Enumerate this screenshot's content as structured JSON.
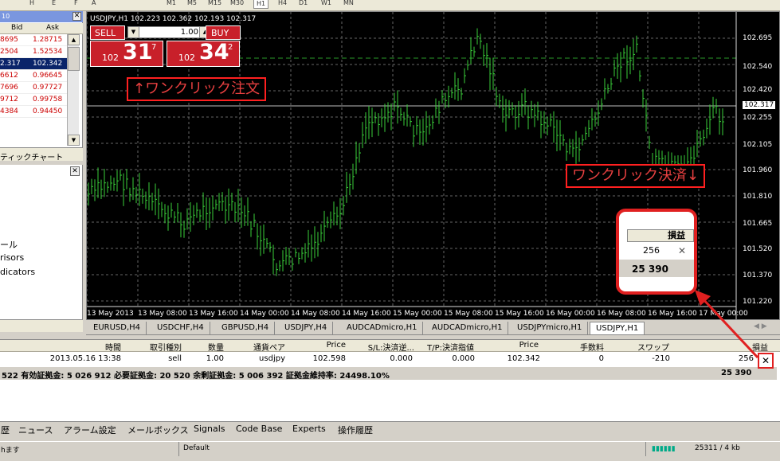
{
  "toolbar": {
    "items": [
      "H",
      "E",
      "F",
      "A",
      "M1",
      "M5",
      "M15",
      "M30",
      "H1",
      "H4",
      "D1",
      "W1",
      "MN"
    ],
    "active": "H1"
  },
  "market_watch": {
    "title": "10",
    "col_bid": "Bid",
    "col_ask": "Ask",
    "rows": [
      {
        "bid": "8695",
        "ask": "1.28715"
      },
      {
        "bid": "2504",
        "ask": "1.52534"
      },
      {
        "bid": "2.317",
        "ask": "102.342",
        "selected": true
      },
      {
        "bid": "6612",
        "ask": "0.96645"
      },
      {
        "bid": "7696",
        "ask": "0.97727"
      },
      {
        "bid": "9712",
        "ask": "0.99758"
      },
      {
        "bid": "4384",
        "ask": "0.94450"
      }
    ],
    "tab": "ティックチャート"
  },
  "navigator": {
    "items": [
      "ール",
      "risors",
      "dicators"
    ]
  },
  "chart": {
    "symbol_line": "USDJPY,H1  102.223 102.362 102.193 102.317",
    "sell_label": "SELL",
    "buy_label": "BUY",
    "lot": "1.00",
    "sell_small": "102",
    "sell_big": "31",
    "sell_sup": "7",
    "buy_small": "102",
    "buy_big": "34",
    "buy_sup": "2",
    "note_order": "↑ワンクリック注文",
    "note_close": "ワンクリック決済↓",
    "popup_header": "損益",
    "popup_value": "256",
    "popup_total": "25 390",
    "y_labels": [
      "102.695",
      "102.540",
      "102.420",
      "102.317",
      "102.255",
      "102.105",
      "101.960",
      "101.810",
      "101.665",
      "101.520",
      "101.370",
      "101.220"
    ],
    "x_labels": [
      "13 May 2013",
      "13 May 08:00",
      "13 May 16:00",
      "14 May 00:00",
      "14 May 08:00",
      "14 May 16:00",
      "15 May 00:00",
      "15 May 08:00",
      "15 May 16:00",
      "16 May 00:00",
      "16 May 08:00",
      "16 May 16:00",
      "17 May 00:00"
    ]
  },
  "chart_tabs": [
    "EURUSD,H4",
    "USDCHF,H4",
    "GBPUSD,H4",
    "USDJPY,H4",
    "AUDCADmicro,H1",
    "AUDCADmicro,H1",
    "USDJPYmicro,H1",
    "USDJPY,H1"
  ],
  "terminal": {
    "headers": [
      "時間",
      "取引種別",
      "数量",
      "通貨ペア",
      "Price",
      "S/L:決済逆...",
      "T/P:決済指値",
      "Price",
      "手数料",
      "スワップ",
      "損益"
    ],
    "row": [
      "2013.05.16 13:38",
      "sell",
      "1.00",
      "usdjpy",
      "102.598",
      "0.000",
      "0.000",
      "102.342",
      "0",
      "-210",
      "256"
    ],
    "balance": "522  有効証拠金: 5 026 912  必要証拠金: 20 520  余剰証拠金: 5 006 392  証拠金維持率: 24498.10%",
    "balance_pl": "25 390"
  },
  "bottom_tabs": [
    "歴",
    "ニュース",
    "アラーム設定",
    "メールボックス",
    "Signals",
    "Code Base",
    "Experts",
    "操作履歴"
  ],
  "status": {
    "left": "hます",
    "profile": "Default",
    "traffic": "25311 / 4 kb"
  }
}
